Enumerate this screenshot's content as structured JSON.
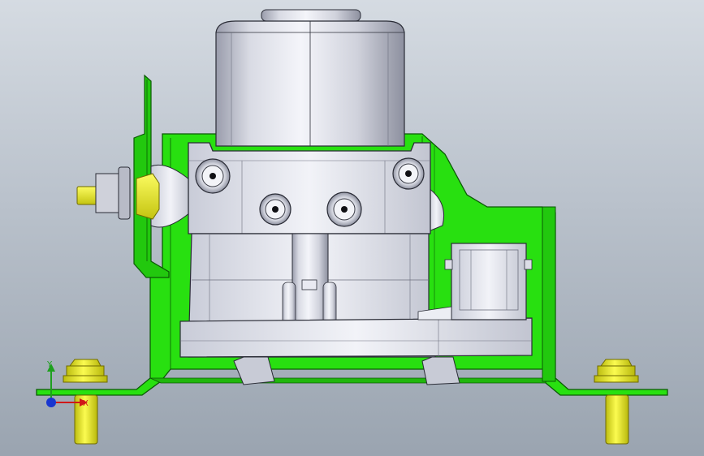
{
  "viewport": {
    "background_top": "#d5dbe2",
    "background_bottom": "#9aa4b0",
    "model_icon": "abs-hydraulic-unit-assembly"
  },
  "colors": {
    "bracket": "#28e010",
    "bracket_edge": "#0b5a05",
    "metal_light": "#eef0f6",
    "metal_mid": "#c3c6d2",
    "metal_dark": "#8a8d9c",
    "fastener": "#f2f230",
    "fastener_edge": "#6f6a00",
    "edge": "#2a2c36"
  },
  "triad": {
    "y_label": "Y",
    "x_label": "X",
    "y_color": "#1ea01e",
    "x_color": "#d01818",
    "z_color": "#1836d0"
  }
}
